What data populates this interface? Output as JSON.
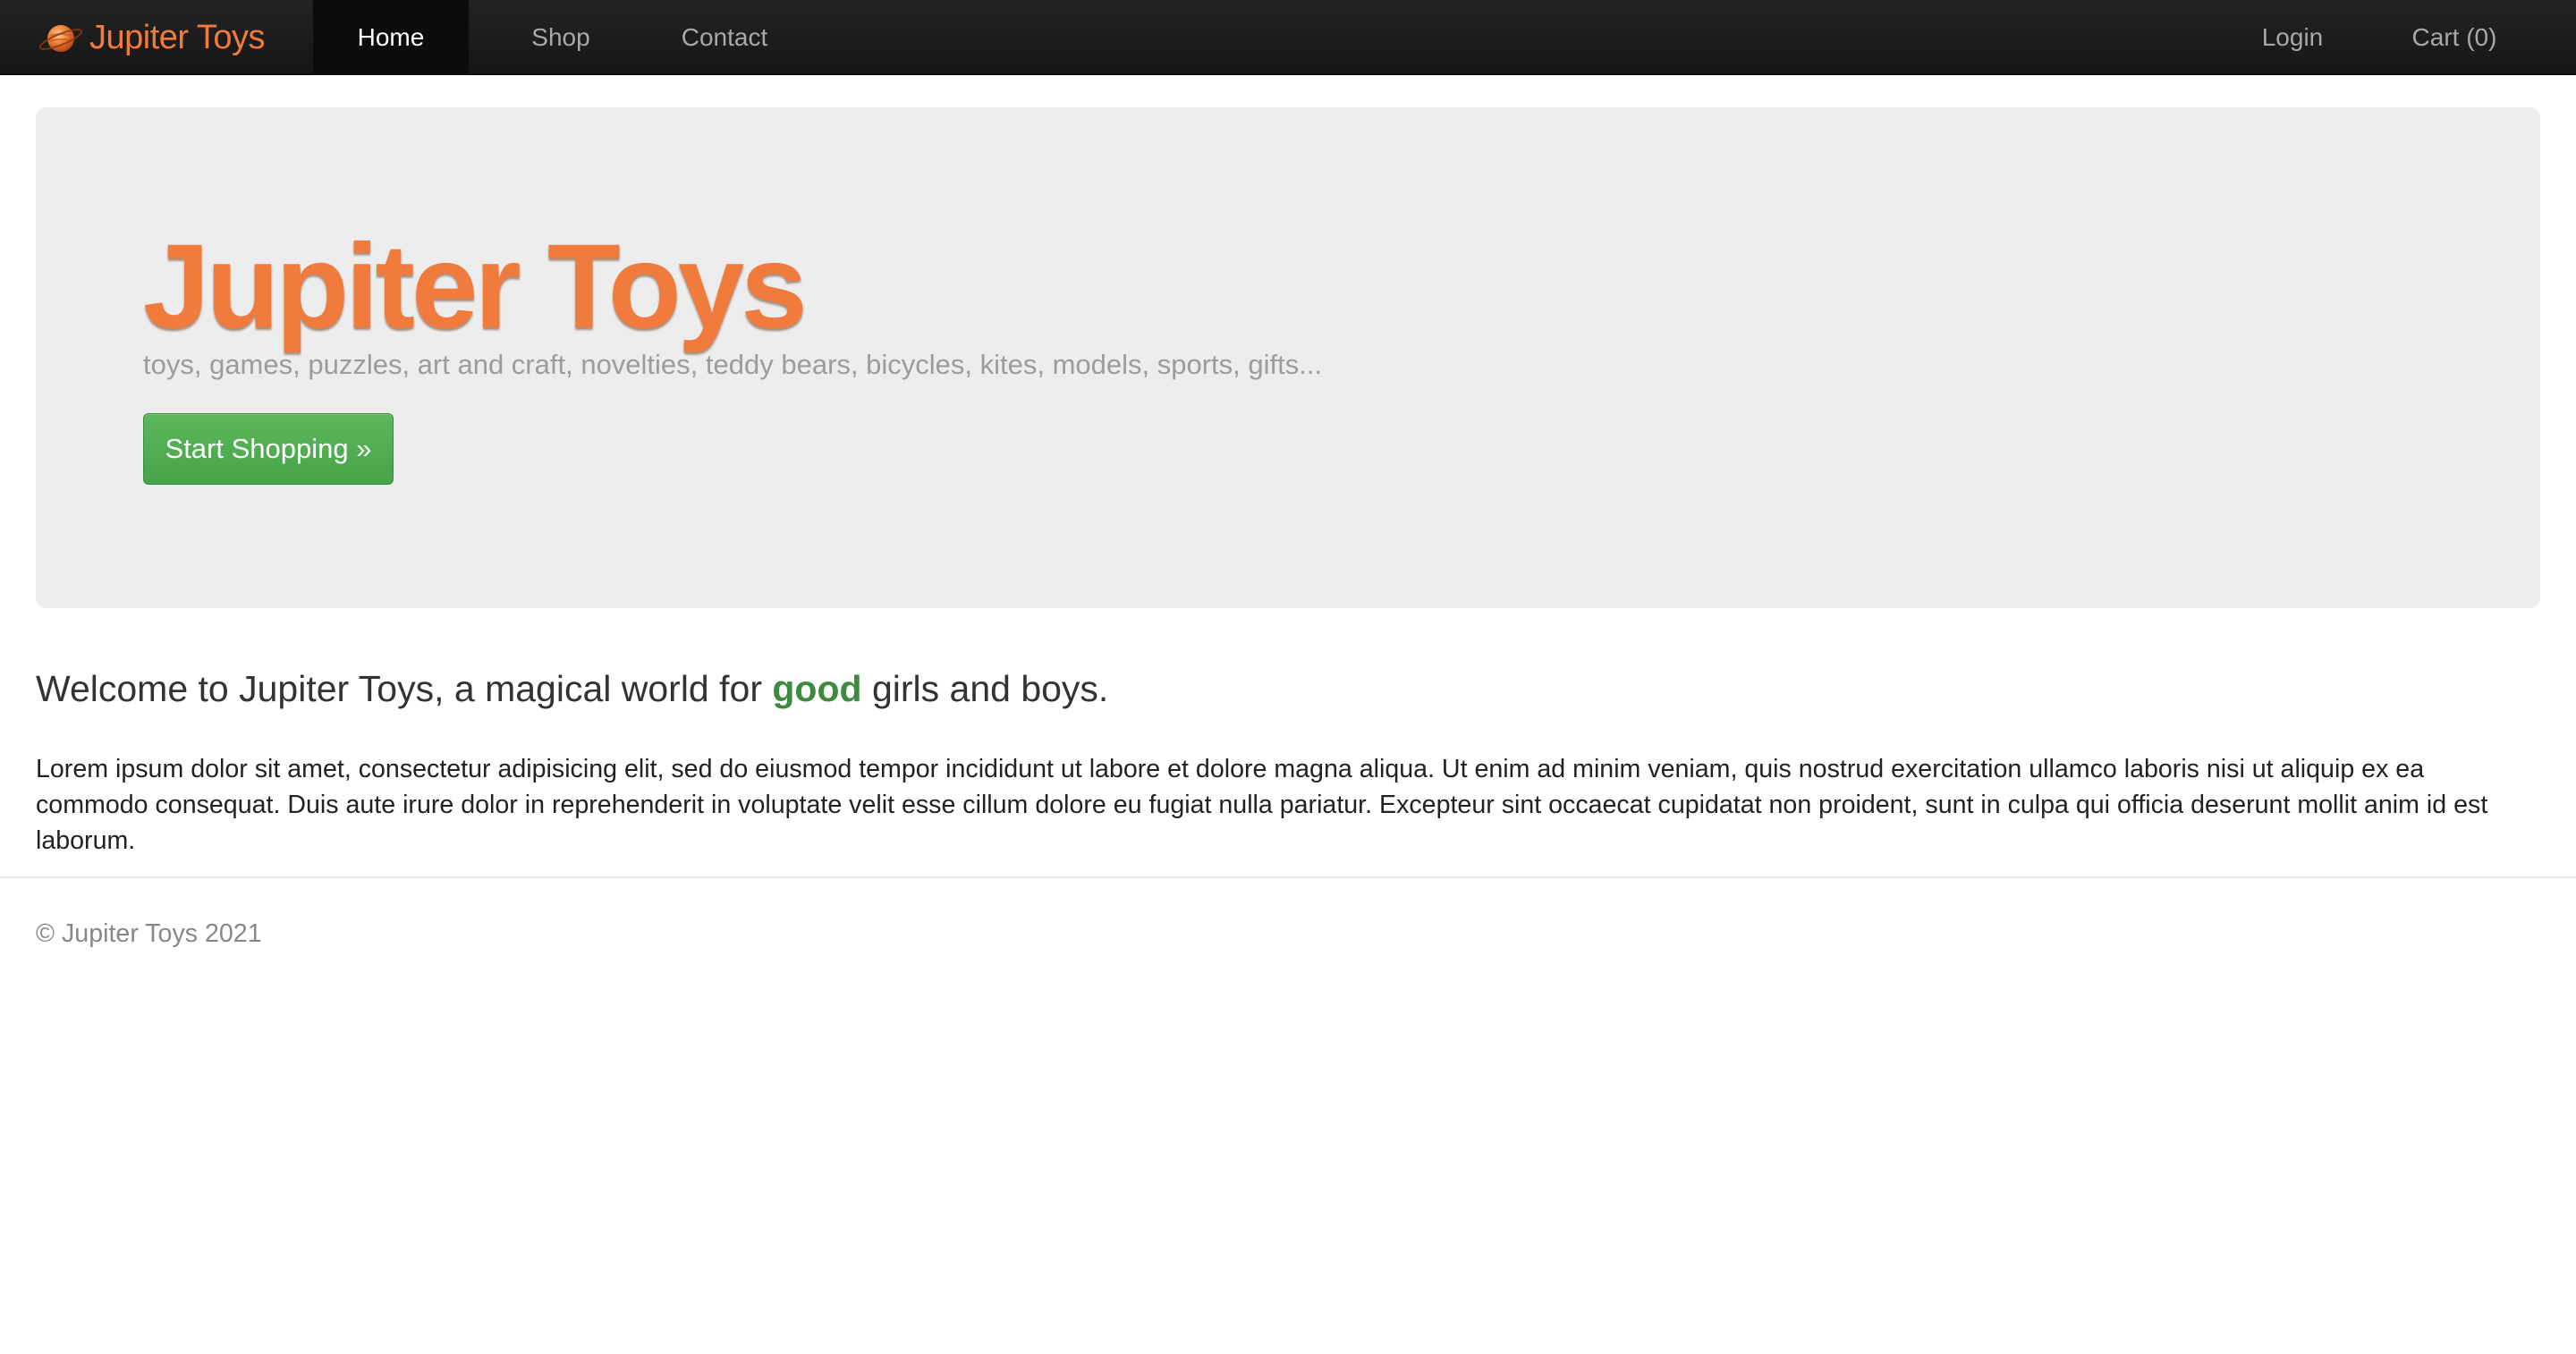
{
  "navbar": {
    "brand": "Jupiter Toys",
    "brand_icon": "planet-logo-icon",
    "items": [
      {
        "label": "Home",
        "active": true
      },
      {
        "label": "Shop",
        "active": false
      },
      {
        "label": "Contact",
        "active": false
      }
    ],
    "right_items": [
      {
        "label": "Login"
      },
      {
        "label": "Cart (0)"
      }
    ]
  },
  "hero": {
    "title": "Jupiter Toys",
    "subtitle": "toys, games, puzzles, art and craft, novelties, teddy bears, bicycles, kites, models, sports, gifts...",
    "button_label": "Start Shopping »"
  },
  "welcome": {
    "before": "Welcome to Jupiter Toys, a magical world for ",
    "emphasis": "good",
    "after": " girls and boys."
  },
  "body_text": "Lorem ipsum dolor sit amet, consectetur adipisicing elit, sed do eiusmod tempor incididunt ut labore et dolore magna aliqua. Ut enim ad minim veniam, quis nostrud exercitation ullamco laboris nisi ut aliquip ex ea commodo consequat. Duis aute irure dolor in reprehenderit in voluptate velit esse cillum dolore eu fugiat nulla pariatur. Excepteur sint occaecat cupidatat non proident, sunt in culpa qui officia deserunt mollit anim id est laborum.",
  "footer": {
    "copyright": "© Jupiter Toys 2021"
  },
  "colors": {
    "brand_orange": "#f07b3c",
    "navbar_bg": "#1b1b1b",
    "hero_bg": "#ededed",
    "button_green": "#5cb85c",
    "good_green": "#3e8a3e"
  }
}
